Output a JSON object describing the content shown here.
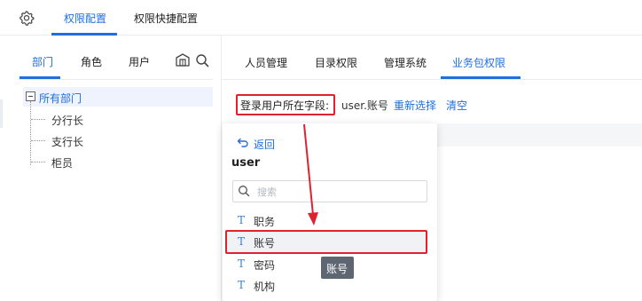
{
  "top_tabs": [
    {
      "label": "权限配置",
      "active": true
    },
    {
      "label": "权限快捷配置",
      "active": false
    }
  ],
  "left_panel": {
    "tabs": [
      {
        "label": "部门",
        "active": true
      },
      {
        "label": "角色",
        "active": false
      },
      {
        "label": "用户",
        "active": false
      }
    ],
    "icons": [
      "building-icon",
      "search-icon"
    ],
    "tree": {
      "root": "所有部门",
      "children": [
        "分行长",
        "支行长",
        "柜员"
      ]
    }
  },
  "right_panel": {
    "tabs": [
      {
        "label": "人员管理",
        "active": false
      },
      {
        "label": "目录权限",
        "active": false
      },
      {
        "label": "管理系统",
        "active": false
      },
      {
        "label": "业务包权限",
        "active": true
      }
    ],
    "field_label": "登录用户所在字段:",
    "field_value": "user.账号",
    "reselect_link": "重新选择",
    "clear_link": "清空"
  },
  "dropdown": {
    "back_label": "返回",
    "title": "user",
    "search_placeholder": "搜索",
    "type_glyph": "T",
    "items": [
      {
        "label": "职务",
        "selected": false
      },
      {
        "label": "账号",
        "selected": true
      },
      {
        "label": "密码",
        "selected": false
      },
      {
        "label": "机构",
        "selected": false
      }
    ]
  },
  "tooltip": "账号",
  "colors": {
    "accent": "#1f6fe0",
    "highlight_red": "#e0212e",
    "tooltip_bg": "#5e6671"
  }
}
